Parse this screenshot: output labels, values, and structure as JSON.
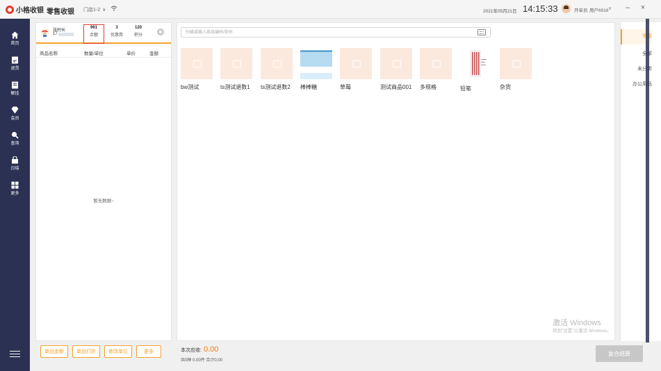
{
  "titlebar": {
    "logo_text": "小格收银",
    "mode": "零售收银",
    "store": "门店1-2",
    "store_caret": "∨",
    "date": "2021年05月21日",
    "time": "14:15:33",
    "user_role": "开单员",
    "user_id": "用户6918",
    "user_caret": "∨",
    "minimize": "–",
    "close": "×"
  },
  "nav": {
    "items": [
      {
        "label": "首页",
        "icon": "home-icon"
      },
      {
        "label": "退货",
        "icon": "return-icon"
      },
      {
        "label": "解挂",
        "icon": "unhold-icon"
      },
      {
        "label": "会员",
        "icon": "member-icon"
      },
      {
        "label": "查询",
        "icon": "search-icon"
      },
      {
        "label": "日结",
        "icon": "daily-close-icon"
      },
      {
        "label": "更多",
        "icon": "more-grid-icon"
      }
    ]
  },
  "member": {
    "name": "张村长",
    "phone_prefix": "17",
    "balance_value": "961",
    "balance_label": "余额",
    "coupon_value": "3",
    "coupon_label": "优惠券",
    "points_value": "120",
    "points_label": "积分"
  },
  "cart": {
    "columns": [
      "商品名称",
      "数量/单位",
      "单价",
      "金额"
    ],
    "empty_text": "暂无数据~",
    "actions": [
      "单品金额",
      "单品打折",
      "修改单位",
      "更多"
    ]
  },
  "search": {
    "placeholder": "扫描或输入商品编码/条码"
  },
  "products": [
    {
      "name": "bw测试",
      "thumb": "placeholder"
    },
    {
      "name": "ts测试退数1",
      "thumb": "placeholder"
    },
    {
      "name": "ts测试退数2",
      "thumb": "placeholder"
    },
    {
      "name": "棒棒糖",
      "thumb": "sky-photo"
    },
    {
      "name": "草莓",
      "thumb": "placeholder"
    },
    {
      "name": "测试商品001",
      "thumb": "placeholder"
    },
    {
      "name": "多规格",
      "thumb": "placeholder"
    },
    {
      "name": "铅笔",
      "thumb": "pencil-photo"
    },
    {
      "name": "杂货",
      "thumb": "placeholder"
    }
  ],
  "categories": [
    "常用",
    "全部",
    "未分类",
    "办公用品"
  ],
  "bottom": {
    "due_label": "本次应收:",
    "due_amount": "0.00",
    "summary": "共0种 0.00件 合计0.00",
    "checkout": "复合结算"
  },
  "watermark": {
    "title": "激活 Windows",
    "subtitle": "转到\"设置\"以激活 Windows。"
  },
  "colors": {
    "nav_bg": "#2b3152",
    "accent": "#f5a02a",
    "highlight": "#e53935",
    "due_amount": "#f57c00"
  }
}
